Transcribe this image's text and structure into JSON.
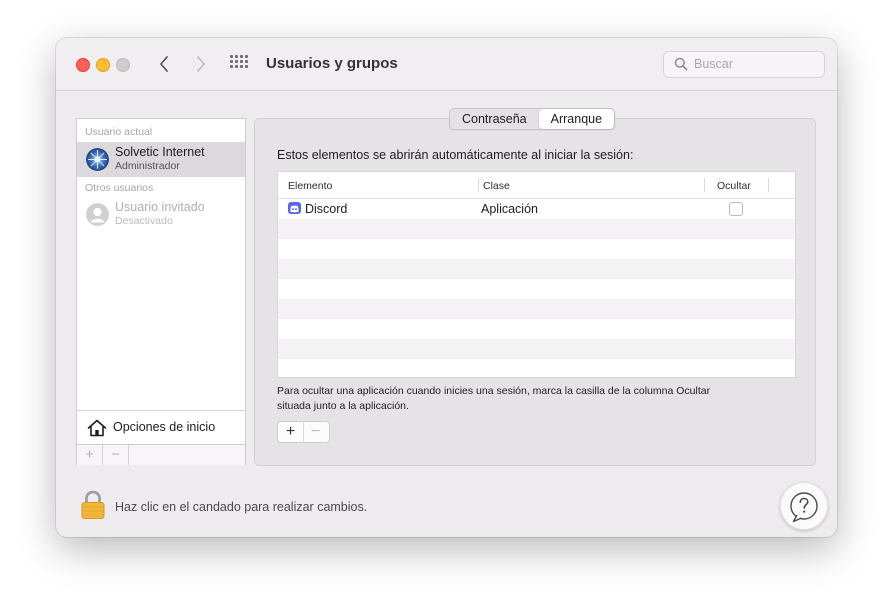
{
  "window": {
    "title": "Usuarios y grupos",
    "search_placeholder": "Buscar"
  },
  "sidebar": {
    "current_user_label": "Usuario actual",
    "current_user": {
      "name": "Solvetic Internet",
      "role": "Administrador"
    },
    "other_users_label": "Otros usuarios",
    "other_users": [
      {
        "name": "Usuario invitado",
        "role": "Desactivado"
      }
    ],
    "login_options_label": "Opciones de inicio",
    "add_label": "+",
    "remove_label": "−"
  },
  "tabs": [
    {
      "label": "Contraseña",
      "active": false
    },
    {
      "label": "Arranque",
      "active": true
    }
  ],
  "startup": {
    "intro": "Estos elementos se abrirán automáticamente al iniciar la sesión:",
    "columns": [
      "Elemento",
      "Clase",
      "Ocultar"
    ],
    "items": [
      {
        "name": "Discord",
        "kind": "Aplicación",
        "hidden": false,
        "icon": "discord-icon"
      }
    ],
    "help_text_line1": "Para ocultar una aplicación cuando inicies una sesión, marca la casilla de la columna Ocultar",
    "help_text_line2": "situada junto a la aplicación.",
    "add_label": "+",
    "remove_label": "−"
  },
  "footer": {
    "lock_text": "Haz clic en el candado para realizar cambios."
  },
  "colors": {
    "close": "#fe5f57",
    "minimize": "#febc2e",
    "zoom_disabled": "#cfccd0",
    "selection": "#dcd9dc",
    "discord": "#5865f2",
    "lock": "#f2b63a"
  }
}
